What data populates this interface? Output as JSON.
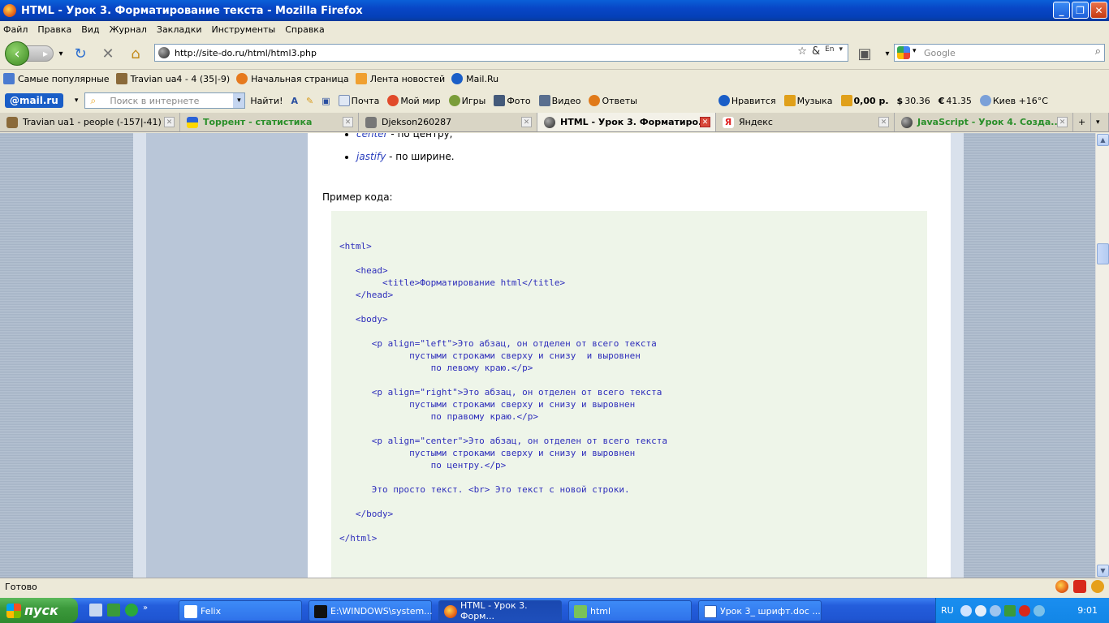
{
  "window": {
    "title": "HTML - Урок 3. Форматирование текста - Mozilla Firefox"
  },
  "menu": [
    "Файл",
    "Правка",
    "Вид",
    "Журнал",
    "Закладки",
    "Инструменты",
    "Справка"
  ],
  "nav": {
    "url": "http://site-do.ru/html/html3.php",
    "search_placeholder": "Google"
  },
  "bookmarks": [
    {
      "label": "Самые популярные",
      "color": "#4a7bd0"
    },
    {
      "label": "Travian ua4 - 4 (35|-9)",
      "color": "#8a6a3a"
    },
    {
      "label": "Начальная страница",
      "color": "#e67a1e"
    },
    {
      "label": "Лента новостей",
      "color": "#f0a030"
    },
    {
      "label": "Mail.Ru",
      "color": "#1a5ec7"
    }
  ],
  "mailbar": {
    "logo": "@mail.ru",
    "search_placeholder": "Поиск в интернете",
    "find_label": "Найти!",
    "buttons": [
      "Почта",
      "Мой мир",
      "Игры",
      "Фото",
      "Видео",
      "Ответы"
    ],
    "right": [
      "Нравится",
      "Музыка",
      "0,00 р.",
      "30.36",
      "41.35",
      "Киев +16°C"
    ]
  },
  "tabs": [
    {
      "label": "Travian ua1 - people (-157|-41)",
      "color": "#8a6a3a",
      "active": false,
      "green": false
    },
    {
      "label": "Торрент - статистика",
      "color": "#ffd700",
      "active": false,
      "green": true
    },
    {
      "label": "Djekson260287",
      "color": "#777777",
      "active": false,
      "green": false
    },
    {
      "label": "HTML - Урок 3. Форматиро...",
      "color": "#333333",
      "active": true,
      "green": false
    },
    {
      "label": "Яндекс",
      "color": "#e02020",
      "active": false,
      "green": false
    },
    {
      "label": "JavaScript - Урок 4. Созда...",
      "color": "#333333",
      "active": false,
      "green": true
    }
  ],
  "content": {
    "list_items": [
      {
        "term": "center",
        "rest": " - по центру;"
      },
      {
        "term": "jastify",
        "rest": " - по ширине."
      }
    ],
    "example_label": "Пример кода:",
    "code_lines": [
      "<html>",
      "",
      "   <head>",
      "        <title>Форматирование html</title>",
      "   </head>",
      "",
      "   <body>",
      "",
      "      <p align=\"left\">Это абзац, он отделен от всего текста",
      "             пустыми строками сверху и снизу  и выровнен",
      "                 по левому краю.</p>",
      "",
      "      <p align=\"right\">Это абзац, он отделен от всего текста",
      "             пустыми строками сверху и снизу и выровнен",
      "                 по правому краю.</p>",
      "",
      "      <p align=\"center\">Это абзац, он отделен от всего текста",
      "             пустыми строками сверху и снизу и выровнен",
      "                 по центру.</p>",
      "",
      "      Это просто текст. <br> Это текст с новой строки.",
      "",
      "   </body>",
      "",
      "</html>"
    ]
  },
  "status": {
    "text": "Готово"
  },
  "taskbar": {
    "start_label": "пуск",
    "tasks": [
      {
        "label": "Felix",
        "active": false
      },
      {
        "label": "E:\\WINDOWS\\system...",
        "active": false
      },
      {
        "label": "HTML - Урок 3. Форм...",
        "active": true
      },
      {
        "label": "html",
        "active": false
      },
      {
        "label": "Урок 3_ шрифт.doc ...",
        "active": false
      }
    ],
    "lang": "RU",
    "clock": "9:01"
  }
}
